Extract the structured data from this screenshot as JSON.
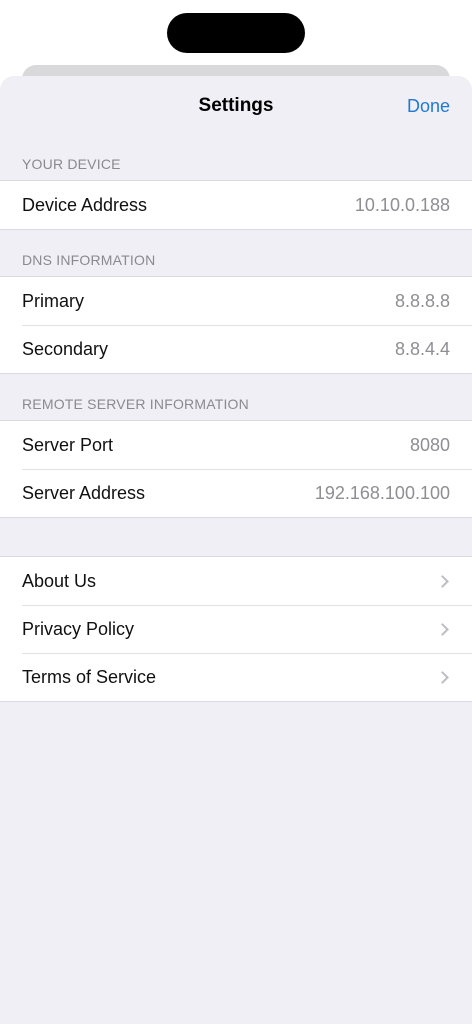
{
  "navbar": {
    "title": "Settings",
    "done_label": "Done"
  },
  "sections": {
    "device": {
      "header": "YOUR DEVICE",
      "rows": [
        {
          "label": "Device Address",
          "value": "10.10.0.188"
        }
      ]
    },
    "dns": {
      "header": "DNS INFORMATION",
      "rows": [
        {
          "label": "Primary",
          "value": "8.8.8.8"
        },
        {
          "label": "Secondary",
          "value": "8.8.4.4"
        }
      ]
    },
    "remote": {
      "header": "REMOTE SERVER INFORMATION",
      "rows": [
        {
          "label": "Server Port",
          "value": "8080"
        },
        {
          "label": "Server Address",
          "value": "192.168.100.100"
        }
      ]
    },
    "links": {
      "rows": [
        {
          "label": "About Us",
          "icon": "chevron-right-icon"
        },
        {
          "label": "Privacy Policy",
          "icon": "chevron-right-icon"
        },
        {
          "label": "Terms of Service",
          "icon": "chevron-right-icon"
        }
      ]
    }
  },
  "colors": {
    "accent": "#1f7ad6",
    "background": "#f0eff5",
    "secondary_text": "#8e8e93"
  }
}
